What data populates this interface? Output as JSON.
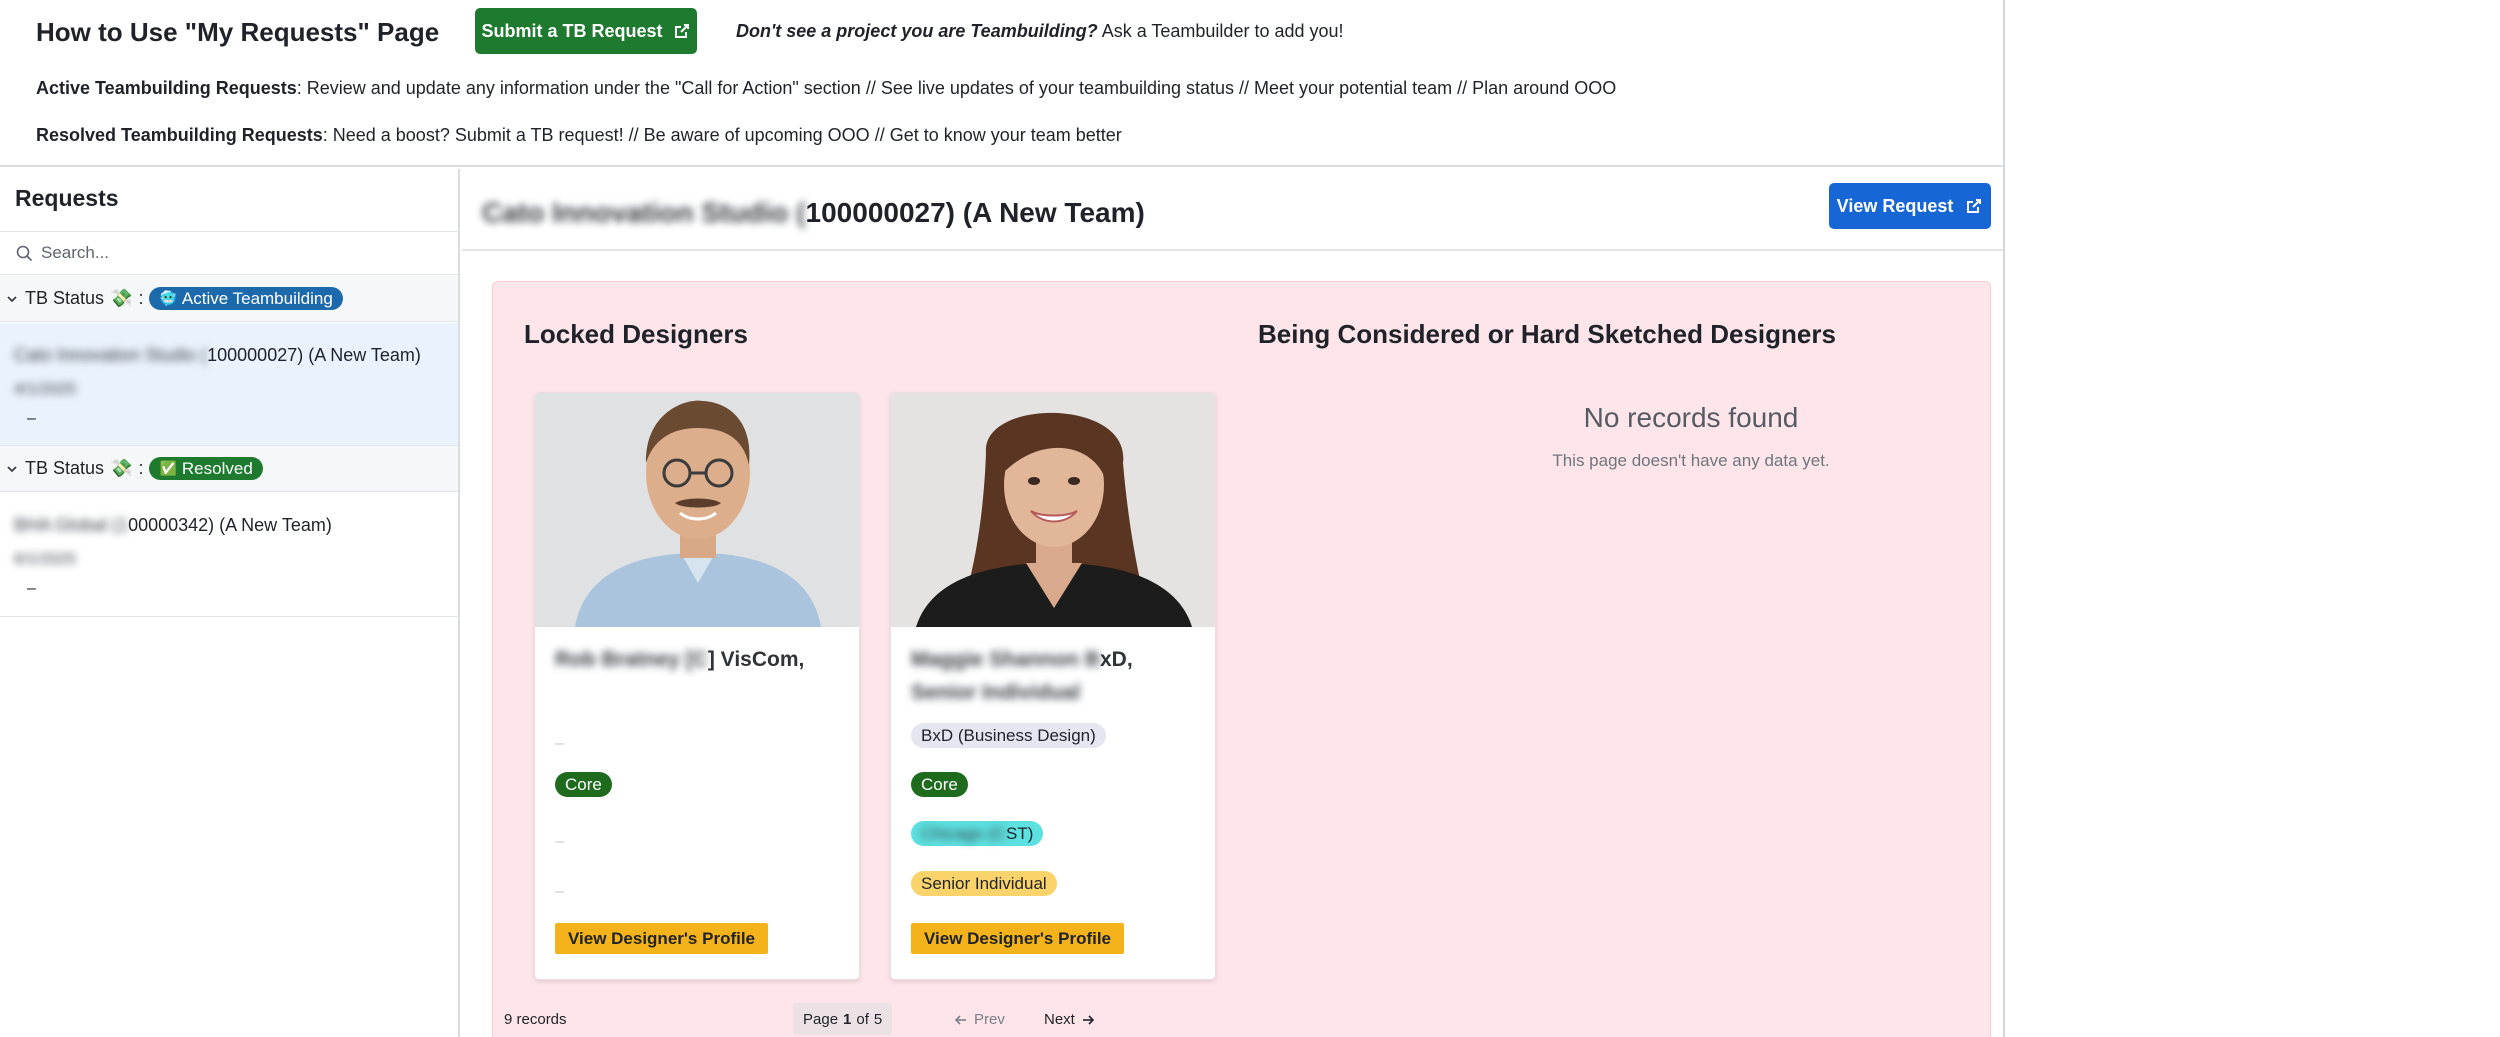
{
  "banner": {
    "title": "How to Use \"My Requests\" Page",
    "submit_label": "Submit a TB Request",
    "note_em": "Don't see a project you are Teambuilding?",
    "note_rest": "Ask a Teambuilder to add you!",
    "active_label": "Active Teambuilding Requests",
    "active_text": ": Review and update any information under the \"Call for Action\" section // See live updates of your teambuilding status // Meet your potential team // Plan around OOO",
    "resolved_label": "Resolved Teambuilding Requests",
    "resolved_text": ": Need a boost? Submit a TB request! // Be aware of upcoming OOO // Get to know your team better"
  },
  "sidebar": {
    "title": "Requests",
    "search_placeholder": "Search...",
    "groups": [
      {
        "prefix": "TB Status",
        "emoji": "💸",
        "badge_emoji": "🥶",
        "badge_label": "Active Teambuilding",
        "badge_color": "#1c6aab",
        "requests": [
          {
            "name_hidden": "Cato Innovation Studio (",
            "name_visible": "100000027) (A New Team)",
            "date": "4/1/2025",
            "dash": "–"
          }
        ]
      },
      {
        "prefix": "TB Status",
        "emoji": "💸",
        "badge_emoji": "✅",
        "badge_label": "Resolved",
        "badge_color": "#1e7a2e",
        "requests": [
          {
            "name_hidden": "BHA Global (1",
            "name_visible": "00000342) (A New Team)",
            "date": "6/1/2025",
            "dash": "–"
          }
        ]
      }
    ]
  },
  "main": {
    "title_hidden": "Cato Innovation Studio (",
    "title_visible": "100000027) (A New Team)",
    "view_request_label": "View Request",
    "locked_title": "Locked Designers",
    "considered_title": "Being Considered or Hard Sketched Designers",
    "empty_title": "No records found",
    "empty_sub": "This page doesn't have any data yet.",
    "cards": [
      {
        "name_hidden": "Rob Bratney [C",
        "name_visible": "] VisCom,",
        "dash1": "–",
        "core": "Core",
        "dash2": "–",
        "dash3": "–",
        "profile_label": "View Designer's Profile"
      },
      {
        "name_hidden": "Maggie Shannon B",
        "name_visible": "xD,",
        "name_line2": "Senior Individual",
        "discipline": "BxD (Business Design)",
        "core": "Core",
        "location_hidden": "Chicago (C",
        "location_visible": "ST)",
        "level": "Senior Individual",
        "profile_label": "View Designer's Profile"
      }
    ],
    "footer": {
      "records": "9 records",
      "page_word": "Page",
      "page_num": "1",
      "of_word": "of",
      "page_total": "5",
      "prev": "Prev",
      "next": "Next"
    }
  },
  "colors": {
    "primary_green": "#1e7a2e",
    "primary_blue": "#1766d6",
    "panel_pink": "#fde5ea",
    "profile_yellow": "#f5b31b",
    "core_green": "#1e6b1e",
    "level_tag": "#fad36b",
    "location_tag": "#5ce1e0",
    "discipline_tag": "#e4e6f0"
  }
}
